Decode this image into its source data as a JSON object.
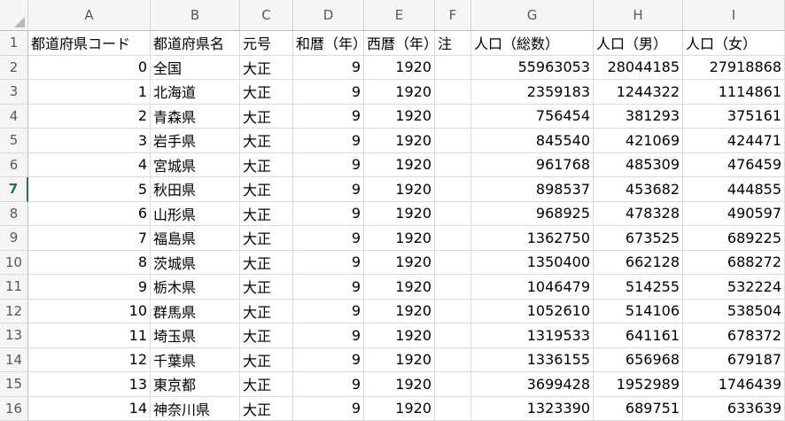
{
  "columns": [
    "A",
    "B",
    "C",
    "D",
    "E",
    "F",
    "G",
    "H",
    "I"
  ],
  "active_row": "7",
  "rows": [
    {
      "n": "1",
      "cells": [
        "都道府県コード",
        "都道府県名",
        "元号",
        "和暦（年）",
        "西暦（年）",
        "注",
        "人口（総数）",
        "人口（男）",
        "人口（女）"
      ]
    },
    {
      "n": "2",
      "cells": [
        "0",
        "全国",
        "大正",
        "9",
        "1920",
        "",
        "55963053",
        "28044185",
        "27918868"
      ]
    },
    {
      "n": "3",
      "cells": [
        "1",
        "北海道",
        "大正",
        "9",
        "1920",
        "",
        "2359183",
        "1244322",
        "1114861"
      ]
    },
    {
      "n": "4",
      "cells": [
        "2",
        "青森県",
        "大正",
        "9",
        "1920",
        "",
        "756454",
        "381293",
        "375161"
      ]
    },
    {
      "n": "5",
      "cells": [
        "3",
        "岩手県",
        "大正",
        "9",
        "1920",
        "",
        "845540",
        "421069",
        "424471"
      ]
    },
    {
      "n": "6",
      "cells": [
        "4",
        "宮城県",
        "大正",
        "9",
        "1920",
        "",
        "961768",
        "485309",
        "476459"
      ]
    },
    {
      "n": "7",
      "cells": [
        "5",
        "秋田県",
        "大正",
        "9",
        "1920",
        "",
        "898537",
        "453682",
        "444855"
      ]
    },
    {
      "n": "8",
      "cells": [
        "6",
        "山形県",
        "大正",
        "9",
        "1920",
        "",
        "968925",
        "478328",
        "490597"
      ]
    },
    {
      "n": "9",
      "cells": [
        "7",
        "福島県",
        "大正",
        "9",
        "1920",
        "",
        "1362750",
        "673525",
        "689225"
      ]
    },
    {
      "n": "10",
      "cells": [
        "8",
        "茨城県",
        "大正",
        "9",
        "1920",
        "",
        "1350400",
        "662128",
        "688272"
      ]
    },
    {
      "n": "11",
      "cells": [
        "9",
        "栃木県",
        "大正",
        "9",
        "1920",
        "",
        "1046479",
        "514255",
        "532224"
      ]
    },
    {
      "n": "12",
      "cells": [
        "10",
        "群馬県",
        "大正",
        "9",
        "1920",
        "",
        "1052610",
        "514106",
        "538504"
      ]
    },
    {
      "n": "13",
      "cells": [
        "11",
        "埼玉県",
        "大正",
        "9",
        "1920",
        "",
        "1319533",
        "641161",
        "678372"
      ]
    },
    {
      "n": "14",
      "cells": [
        "12",
        "千葉県",
        "大正",
        "9",
        "1920",
        "",
        "1336155",
        "656968",
        "679187"
      ]
    },
    {
      "n": "15",
      "cells": [
        "13",
        "東京都",
        "大正",
        "9",
        "1920",
        "",
        "3699428",
        "1952989",
        "1746439"
      ]
    },
    {
      "n": "16",
      "cells": [
        "14",
        "神奈川県",
        "大正",
        "9",
        "1920",
        "",
        "1323390",
        "689751",
        "633639"
      ]
    }
  ]
}
